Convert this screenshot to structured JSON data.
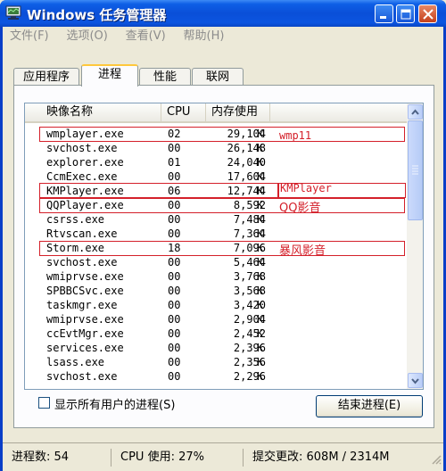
{
  "window": {
    "title": "Windows 任务管理器"
  },
  "menu": [
    "文件(F)",
    "选项(O)",
    "查看(V)",
    "帮助(H)"
  ],
  "tabs": [
    {
      "label": "应用程序",
      "active": false
    },
    {
      "label": "进程",
      "active": true
    },
    {
      "label": "性能",
      "active": false
    },
    {
      "label": "联网",
      "active": false
    }
  ],
  "columns": {
    "name": "映像名称",
    "cpu": "CPU",
    "mem": "内存使用"
  },
  "mem_unit": "K",
  "processes": [
    {
      "name": "wmplayer.exe",
      "cpu": "02",
      "mem": "29,104"
    },
    {
      "name": "svchost.exe",
      "cpu": "00",
      "mem": "26,148"
    },
    {
      "name": "explorer.exe",
      "cpu": "01",
      "mem": "24,040"
    },
    {
      "name": "CcmExec.exe",
      "cpu": "00",
      "mem": "17,604"
    },
    {
      "name": "KMPlayer.exe",
      "cpu": "06",
      "mem": "12,744"
    },
    {
      "name": "QQPlayer.exe",
      "cpu": "00",
      "mem": "8,592"
    },
    {
      "name": "csrss.exe",
      "cpu": "00",
      "mem": "7,484"
    },
    {
      "name": "Rtvscan.exe",
      "cpu": "00",
      "mem": "7,364"
    },
    {
      "name": "Storm.exe",
      "cpu": "18",
      "mem": "7,096"
    },
    {
      "name": "svchost.exe",
      "cpu": "00",
      "mem": "5,464"
    },
    {
      "name": "wmiprvse.exe",
      "cpu": "00",
      "mem": "3,768"
    },
    {
      "name": "SPBBCSvc.exe",
      "cpu": "00",
      "mem": "3,568"
    },
    {
      "name": "taskmgr.exe",
      "cpu": "00",
      "mem": "3,420"
    },
    {
      "name": "wmiprvse.exe",
      "cpu": "00",
      "mem": "2,904"
    },
    {
      "name": "ccEvtMgr.exe",
      "cpu": "00",
      "mem": "2,452"
    },
    {
      "name": "services.exe",
      "cpu": "00",
      "mem": "2,396"
    },
    {
      "name": "lsass.exe",
      "cpu": "00",
      "mem": "2,356"
    },
    {
      "name": "svchost.exe",
      "cpu": "00",
      "mem": "2,296"
    }
  ],
  "annotations": {
    "wmp": "wmp11",
    "kmplayer": "KMPlayer",
    "qqplayer": "QQ影音",
    "storm": "暴风影音"
  },
  "annotation_color": "#d4202a",
  "show_all_users": "显示所有用户的进程(S)",
  "end_process": "结束进程(E)",
  "status": {
    "processes": "进程数: 54",
    "cpu": "CPU 使用: 27%",
    "commit": "提交更改: 608M / 2314M"
  }
}
